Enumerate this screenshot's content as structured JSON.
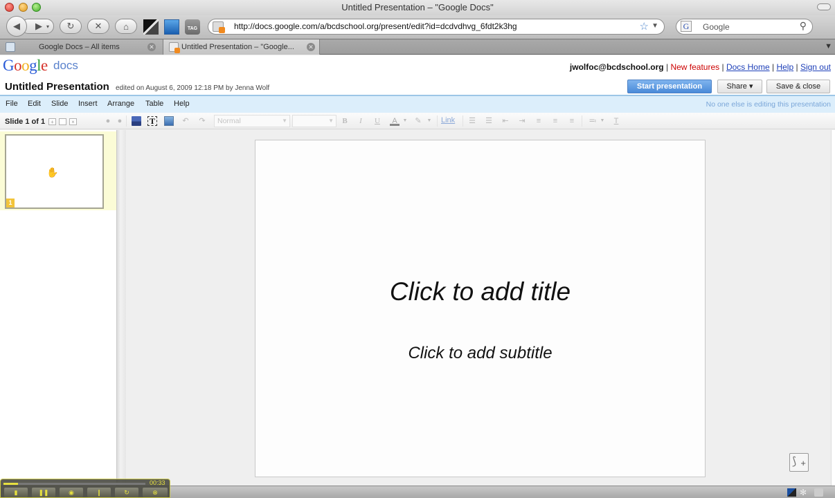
{
  "window": {
    "title": "Untitled Presentation – \"Google Docs\""
  },
  "browser": {
    "url": "http://docs.google.com/a/bcdschool.org/present/edit?id=dcdvdhvg_6fdt2k3hg",
    "search_placeholder": "Google",
    "search_engine_glyph": "G",
    "ext_tag_label": "TAG",
    "icons": [
      "back-icon",
      "forward-icon",
      "reload-icon",
      "stop-icon",
      "home-icon",
      "bookmark-star-icon",
      "search-icon"
    ],
    "tabs": [
      {
        "label": "Google Docs – All items",
        "active": false
      },
      {
        "label": "Untitled Presentation – \"Google...",
        "active": true
      }
    ]
  },
  "docs": {
    "logo_word": "Google",
    "logo_product": "docs",
    "user_email": "jwolfoc@bcdschool.org",
    "links": {
      "new_features": "New features",
      "docs_home": "Docs Home",
      "help": "Help",
      "sign_out": "Sign out"
    },
    "separator": "|",
    "doc_title": "Untitled Presentation",
    "edited_info": "edited on August 6, 2009 12:18 PM by Jenna Wolf",
    "buttons": {
      "start_presentation": "Start presentation",
      "share": "Share ▾",
      "save_close": "Save & close"
    },
    "menu": [
      "File",
      "Edit",
      "Slide",
      "Insert",
      "Arrange",
      "Table",
      "Help"
    ],
    "collab_status": "No one else is editing this presentation",
    "toolbar": {
      "slide_count": "Slide 1 of 1",
      "style_select": "Normal",
      "size_select": "",
      "bold": "B",
      "italic": "I",
      "underline": "U",
      "text_color": "A",
      "link": "Link"
    },
    "filmstrip": {
      "slides": [
        {
          "number": "1",
          "selected": true
        }
      ]
    },
    "slide": {
      "title_placeholder": "Click to add title",
      "subtitle_placeholder": "Click to add subtitle"
    }
  },
  "recorder": {
    "elapsed": "00:33",
    "progress": 0.1
  },
  "colors": {
    "accent_blue": "#4a8ad8",
    "menubar_bg": "#dceefb",
    "new_features_red": "#cc0000",
    "link_blue": "#1d3fb8",
    "filmstrip_selected": "#fbfcd6",
    "slide_number_badge": "#f2c43a"
  }
}
